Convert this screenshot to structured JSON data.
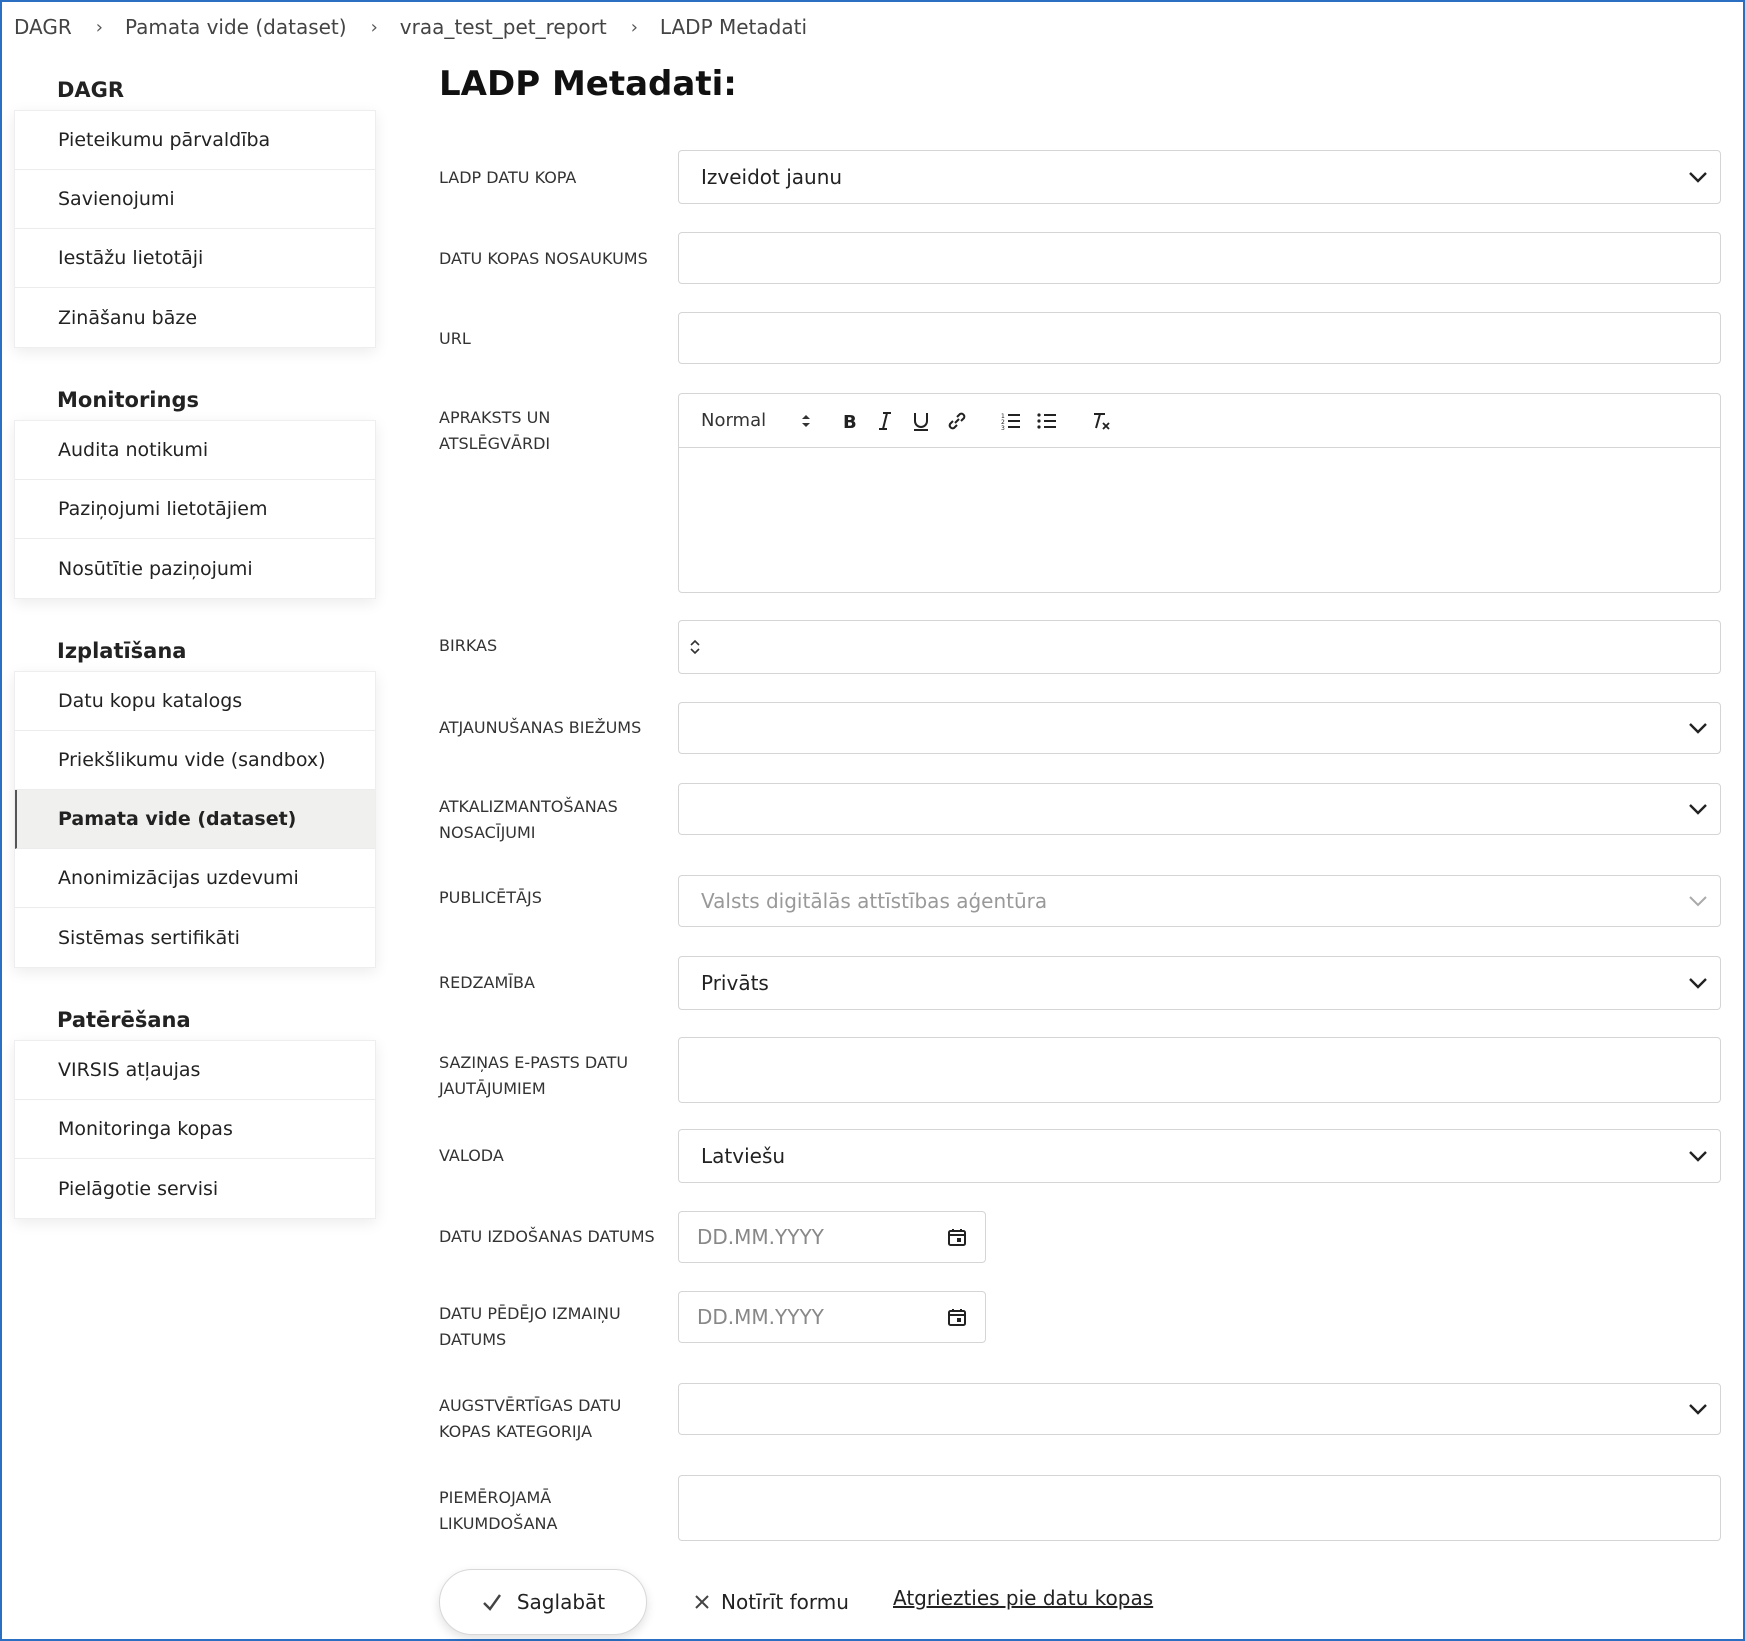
{
  "breadcrumb": [
    "DAGR",
    "Pamata vide (dataset)",
    "vraa_test_pet_report",
    "LADP Metadati"
  ],
  "sidebar": {
    "sections": [
      {
        "heading": "DAGR",
        "items": [
          "Pieteikumu pārvaldība",
          "Savienojumi",
          "Iestāžu lietotāji",
          "Zināšanu bāze"
        ]
      },
      {
        "heading": "Monitorings",
        "items": [
          "Audita notikumi",
          "Paziņojumi lietotājiem",
          "Nosūtītie paziņojumi"
        ]
      },
      {
        "heading": "Izplatīšana",
        "items": [
          "Datu kopu katalogs",
          "Priekšlikumu vide (sandbox)",
          "Pamata vide (dataset)",
          "Anonimizācijas uzdevumi",
          "Sistēmas sertifikāti"
        ]
      },
      {
        "heading": "Patērēšana",
        "items": [
          "VIRSIS atļaujas",
          "Monitoringa kopas",
          "Pielāgotie servisi"
        ]
      }
    ],
    "active_item": "Pamata vide (dataset)"
  },
  "page": {
    "title": "LADP Metadati:"
  },
  "form": {
    "ladp_dataset": {
      "label": "LADP DATU KOPA",
      "value": "Izveidot jaunu"
    },
    "dataset_name": {
      "label": "DATU KOPAS NOSAUKUMS",
      "value": ""
    },
    "url": {
      "label": "URL",
      "value": ""
    },
    "description": {
      "label": "APRAKSTS UN ATSLĒGVĀRDI",
      "format": "Normal"
    },
    "tags": {
      "label": "BIRKAS",
      "value": ""
    },
    "update_frequency": {
      "label": "ATJAUNUŠANAS BIEŽUMS",
      "value": ""
    },
    "reuse_conditions": {
      "label": "ATKALIZMANTOŠANAS NOSACĪJUMI",
      "value": ""
    },
    "publisher": {
      "label": "PUBLICĒTĀJS",
      "value": "Valsts digitālās attīstības aģentūra"
    },
    "visibility": {
      "label": "REDZAMĪBA",
      "value": "Privāts"
    },
    "contact_email": {
      "label": "SAZIŅAS E-PASTS DATU JAUTĀJUMIEM",
      "value": ""
    },
    "language": {
      "label": "VALODA",
      "value": "Latviešu"
    },
    "issue_date": {
      "label": "DATU IZDOŠANAS DATUMS",
      "placeholder": "DD.MM.YYYY"
    },
    "modified_date": {
      "label": "DATU PĒDĒJO IZMAIŅU DATUMS",
      "placeholder": "DD.MM.YYYY"
    },
    "hvd_category": {
      "label": "AUGSTVĒRTĪGAS DATU KOPAS KATEGORIJA",
      "value": ""
    },
    "legislation": {
      "label": "PIEMĒROJAMĀ LIKUMDOŠANA",
      "value": ""
    }
  },
  "actions": {
    "save": "Saglabāt",
    "clear": "Notīrīt formu",
    "back": "Atgriezties pie datu kopas"
  },
  "colors": {
    "accent_border": "#2a6fc2",
    "active_bg": "#f0f1ee"
  }
}
